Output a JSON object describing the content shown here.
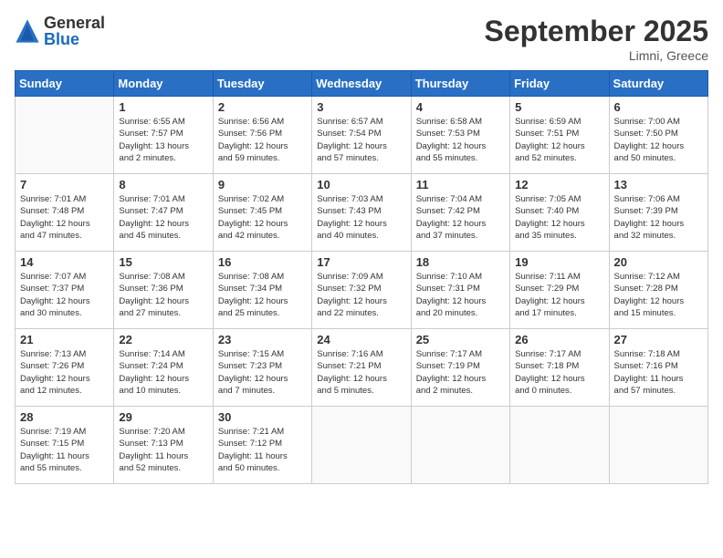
{
  "header": {
    "logo_general": "General",
    "logo_blue": "Blue",
    "month_title": "September 2025",
    "subtitle": "Limni, Greece"
  },
  "days_of_week": [
    "Sunday",
    "Monday",
    "Tuesday",
    "Wednesday",
    "Thursday",
    "Friday",
    "Saturday"
  ],
  "weeks": [
    [
      {
        "day": "",
        "info": ""
      },
      {
        "day": "1",
        "info": "Sunrise: 6:55 AM\nSunset: 7:57 PM\nDaylight: 13 hours\nand 2 minutes."
      },
      {
        "day": "2",
        "info": "Sunrise: 6:56 AM\nSunset: 7:56 PM\nDaylight: 12 hours\nand 59 minutes."
      },
      {
        "day": "3",
        "info": "Sunrise: 6:57 AM\nSunset: 7:54 PM\nDaylight: 12 hours\nand 57 minutes."
      },
      {
        "day": "4",
        "info": "Sunrise: 6:58 AM\nSunset: 7:53 PM\nDaylight: 12 hours\nand 55 minutes."
      },
      {
        "day": "5",
        "info": "Sunrise: 6:59 AM\nSunset: 7:51 PM\nDaylight: 12 hours\nand 52 minutes."
      },
      {
        "day": "6",
        "info": "Sunrise: 7:00 AM\nSunset: 7:50 PM\nDaylight: 12 hours\nand 50 minutes."
      }
    ],
    [
      {
        "day": "7",
        "info": "Sunrise: 7:01 AM\nSunset: 7:48 PM\nDaylight: 12 hours\nand 47 minutes."
      },
      {
        "day": "8",
        "info": "Sunrise: 7:01 AM\nSunset: 7:47 PM\nDaylight: 12 hours\nand 45 minutes."
      },
      {
        "day": "9",
        "info": "Sunrise: 7:02 AM\nSunset: 7:45 PM\nDaylight: 12 hours\nand 42 minutes."
      },
      {
        "day": "10",
        "info": "Sunrise: 7:03 AM\nSunset: 7:43 PM\nDaylight: 12 hours\nand 40 minutes."
      },
      {
        "day": "11",
        "info": "Sunrise: 7:04 AM\nSunset: 7:42 PM\nDaylight: 12 hours\nand 37 minutes."
      },
      {
        "day": "12",
        "info": "Sunrise: 7:05 AM\nSunset: 7:40 PM\nDaylight: 12 hours\nand 35 minutes."
      },
      {
        "day": "13",
        "info": "Sunrise: 7:06 AM\nSunset: 7:39 PM\nDaylight: 12 hours\nand 32 minutes."
      }
    ],
    [
      {
        "day": "14",
        "info": "Sunrise: 7:07 AM\nSunset: 7:37 PM\nDaylight: 12 hours\nand 30 minutes."
      },
      {
        "day": "15",
        "info": "Sunrise: 7:08 AM\nSunset: 7:36 PM\nDaylight: 12 hours\nand 27 minutes."
      },
      {
        "day": "16",
        "info": "Sunrise: 7:08 AM\nSunset: 7:34 PM\nDaylight: 12 hours\nand 25 minutes."
      },
      {
        "day": "17",
        "info": "Sunrise: 7:09 AM\nSunset: 7:32 PM\nDaylight: 12 hours\nand 22 minutes."
      },
      {
        "day": "18",
        "info": "Sunrise: 7:10 AM\nSunset: 7:31 PM\nDaylight: 12 hours\nand 20 minutes."
      },
      {
        "day": "19",
        "info": "Sunrise: 7:11 AM\nSunset: 7:29 PM\nDaylight: 12 hours\nand 17 minutes."
      },
      {
        "day": "20",
        "info": "Sunrise: 7:12 AM\nSunset: 7:28 PM\nDaylight: 12 hours\nand 15 minutes."
      }
    ],
    [
      {
        "day": "21",
        "info": "Sunrise: 7:13 AM\nSunset: 7:26 PM\nDaylight: 12 hours\nand 12 minutes."
      },
      {
        "day": "22",
        "info": "Sunrise: 7:14 AM\nSunset: 7:24 PM\nDaylight: 12 hours\nand 10 minutes."
      },
      {
        "day": "23",
        "info": "Sunrise: 7:15 AM\nSunset: 7:23 PM\nDaylight: 12 hours\nand 7 minutes."
      },
      {
        "day": "24",
        "info": "Sunrise: 7:16 AM\nSunset: 7:21 PM\nDaylight: 12 hours\nand 5 minutes."
      },
      {
        "day": "25",
        "info": "Sunrise: 7:17 AM\nSunset: 7:19 PM\nDaylight: 12 hours\nand 2 minutes."
      },
      {
        "day": "26",
        "info": "Sunrise: 7:17 AM\nSunset: 7:18 PM\nDaylight: 12 hours\nand 0 minutes."
      },
      {
        "day": "27",
        "info": "Sunrise: 7:18 AM\nSunset: 7:16 PM\nDaylight: 11 hours\nand 57 minutes."
      }
    ],
    [
      {
        "day": "28",
        "info": "Sunrise: 7:19 AM\nSunset: 7:15 PM\nDaylight: 11 hours\nand 55 minutes."
      },
      {
        "day": "29",
        "info": "Sunrise: 7:20 AM\nSunset: 7:13 PM\nDaylight: 11 hours\nand 52 minutes."
      },
      {
        "day": "30",
        "info": "Sunrise: 7:21 AM\nSunset: 7:12 PM\nDaylight: 11 hours\nand 50 minutes."
      },
      {
        "day": "",
        "info": ""
      },
      {
        "day": "",
        "info": ""
      },
      {
        "day": "",
        "info": ""
      },
      {
        "day": "",
        "info": ""
      }
    ]
  ]
}
